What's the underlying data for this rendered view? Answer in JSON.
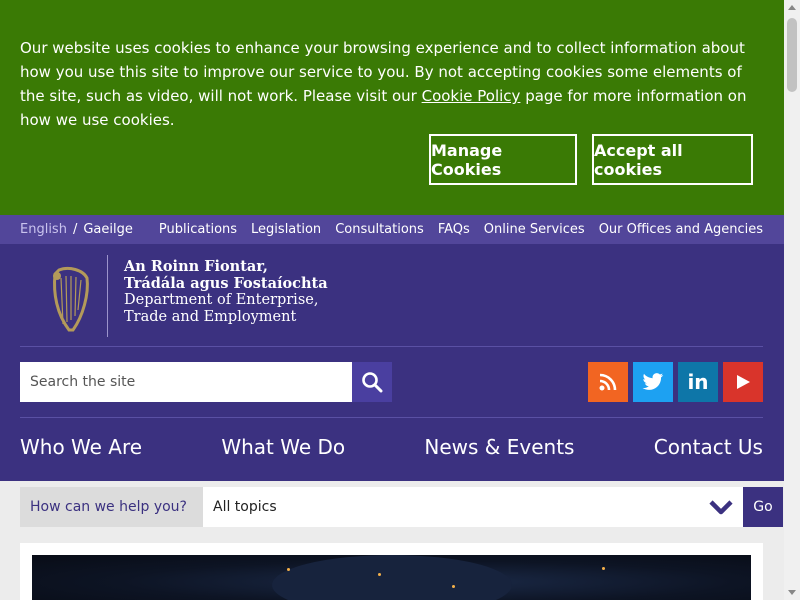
{
  "cookie_banner": {
    "text_before_link": "Our website uses cookies to enhance your browsing experience and to collect information about how you use this site to improve our service to you. By not accepting cookies some elements of the site, such as video, will not work. Please visit our ",
    "link_text": "Cookie Policy",
    "text_after_link": " page for more information on how we use cookies.",
    "manage_label": "Manage Cookies",
    "accept_label": "Accept all cookies",
    "bg_color": "#3a7a05"
  },
  "utility_bar": {
    "languages": [
      "English",
      "Gaeilge"
    ],
    "separator": "/",
    "links": [
      "Publications",
      "Legislation",
      "Consultations",
      "FAQs",
      "Online Services",
      "Our Offices and Agencies"
    ]
  },
  "department": {
    "irish_line1": "An Roinn Fiontar,",
    "irish_line2": "Trádála agus Fostaíochta",
    "english_line1": "Department of Enterprise,",
    "english_line2": "Trade and Employment",
    "logo_icon": "harp-icon"
  },
  "search": {
    "placeholder": "Search the site",
    "button_icon": "search-icon"
  },
  "social": [
    {
      "name": "rss",
      "icon": "rss-icon",
      "color": "#f26522"
    },
    {
      "name": "twitter",
      "icon": "twitter-icon",
      "color": "#1da1f2"
    },
    {
      "name": "linkedin",
      "icon": "linkedin-icon",
      "label": "in",
      "color": "#0e76a8"
    },
    {
      "name": "youtube",
      "icon": "youtube-icon",
      "color": "#d9342b"
    }
  ],
  "main_nav": [
    "Who We Are",
    "What We Do",
    "News & Events",
    "Contact Us"
  ],
  "help_bar": {
    "label": "How can we help you?",
    "selected_topic": "All topics",
    "go_label": "Go"
  },
  "brand_color": "#3b3180"
}
